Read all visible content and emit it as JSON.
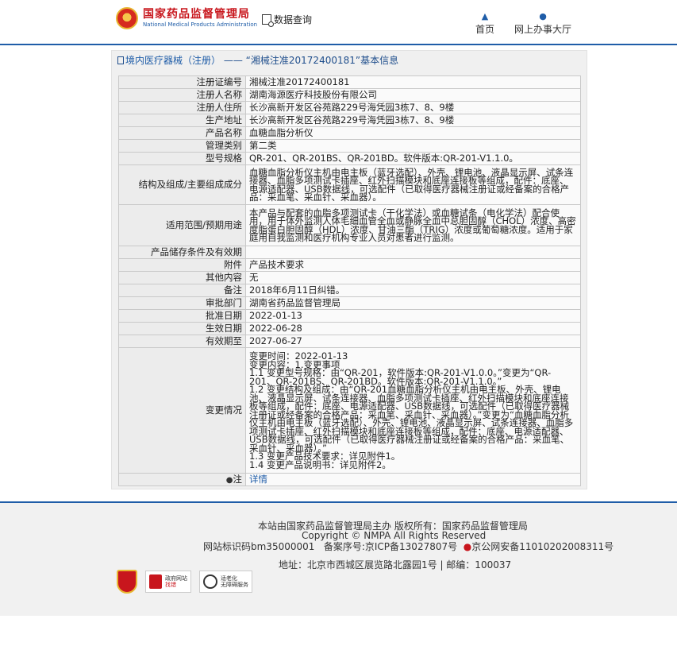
{
  "header": {
    "site_name_cn": "国家药品监督管理局",
    "site_name_en": "National Medical Products Administration",
    "search_label": "数据查询",
    "nav_home": "首页",
    "nav_hall": "网上办事大厅"
  },
  "panel": {
    "category": "境内医疗器械（注册）",
    "separator": "——",
    "title": "“湘械注准20172400181”基本信息"
  },
  "record": {
    "reg_no_label": "注册证编号",
    "reg_no": "湘械注准20172400181",
    "registrant_label": "注册人名称",
    "registrant": "湖南海源医疗科技股份有限公司",
    "address_label": "注册人住所",
    "address": "长沙高新开发区谷苑路229号海凭园3栋7、8、9楼",
    "prod_addr_label": "生产地址",
    "prod_addr": "长沙高新开发区谷苑路229号海凭园3栋7、8、9楼",
    "product_label": "产品名称",
    "product": "血糖血脂分析仪",
    "class_label": "管理类别",
    "class": "第二类",
    "model_label": "型号规格",
    "model": "QR-201、QR-201BS、QR-201BD。软件版本:QR-201-V1.1.0。",
    "structure_label": "结构及组成/主要组成成分",
    "structure": "血糖血脂分析仪主机由电主板（蓝牙选配）、外壳、锂电池、液晶显示屏、试条连接器、血脂多项测试卡插座、红外扫描模块和底座连接板等组成，配件：底座、电源适配器、USB数据线，可选配件（已取得医疗器械注册证或经备案的合格产品：采血笔、采血针、采血器）。",
    "scope_label": "适用范围/预期用途",
    "scope": "本产品与配套的血脂多项测试卡（干化学法）或血糖试条（电化学法）配合使用，用于体外监测人体毛细血管全血或静脉全血中总胆固醇（CHOL）浓度、高密度脂蛋白胆固醇（HDL）浓度、甘油三酯（TRIG）浓度或葡萄糖浓度。适用于家庭用自我监测和医疗机构专业人员对患者进行监测。",
    "storage_label": "产品储存条件及有效期",
    "storage": "",
    "attach_label": "附件",
    "attach": "产品技术要求",
    "other_label": "其他内容",
    "other": "无",
    "remark_label": "备注",
    "remark": "2018年6月11日纠错。",
    "dept_label": "审批部门",
    "dept": "湖南省药品监督管理局",
    "approve_label": "批准日期",
    "approve": "2022-01-13",
    "effective_label": "生效日期",
    "effective": "2022-06-28",
    "expire_label": "有效期至",
    "expire": "2027-06-27",
    "change_label": "变更情况",
    "change_lines": [
      "变更时间：2022-01-13",
      "变更内容：1.变更事项",
      "1.1 变更型号规格：由“QR-201，软件版本:QR-201-V1.0.0。”变更为“QR-201、QR-201BS、QR-201BD。软件版本:QR-201-V1.1.0。”",
      "1.2 变更结构及组成：由“QR-201血糖血脂分析仪主机由电主板、外壳、锂电池、液晶显示屏、试条连接器、血脂多项测试卡插座、红外扫描模块和底座连接板等组成，配件：底座、电源适配器、USB数据线，可选配件（已取得医疗器械注册证或经备案的合格产品：采血笔、采血针、采血器）。”变更为“血糖血脂分析仪主机由电主板（蓝牙选配）、外壳、锂电池、液晶显示屏、试条连接器、血脂多项测试卡插座、红外扫描模块和底座连接板等组成，配件：底座、电源适配器、USB数据线，可选配件（已取得医疗器械注册证或经备案的合格产品：采血笔、采血针、采血器）。”",
      "1.3 变更产品技术要求：详见附件1。",
      "1.4 变更产品说明书：详见附件2。"
    ],
    "note_label": "注",
    "note": "详情"
  },
  "footer": {
    "line1": "本站由国家药品监督管理局主办 版权所有：国家药品监督管理局",
    "line2": "Copyright © NMPA All Rights Reserved",
    "site_id": "网站标识码bm35000001",
    "icp": "备案序号:京ICP备13027807号",
    "police": "京公网安备11010202008311号",
    "address": "地址：北京市西城区展览路北露园1号 | 邮编：100037",
    "badge_gov": "政府网站",
    "badge_gov_sub": "找错",
    "badge_aging": "适老化",
    "badge_aging_sub": "无障碍服务"
  }
}
